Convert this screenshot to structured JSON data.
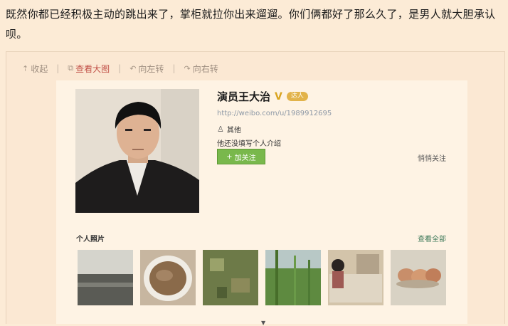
{
  "post": {
    "text": "既然你都已经积极主动的跳出来了，掌柜就拉你出来遛遛。你们俩都好了那么久了，是男人就大胆承认呗。"
  },
  "toolbar": {
    "collect": "收起",
    "view_large": "查看大图",
    "rotate_left": "向左转",
    "rotate_right": "向右转",
    "separator": "|"
  },
  "profile": {
    "name": "演员王大治",
    "verified": "V",
    "badge": "达人",
    "url": "http://weibo.com/u/1989912695",
    "gender": "其他",
    "intro": "他还没填写个人介绍",
    "follow_label": "加关注",
    "secret_follow": "悄悄关注"
  },
  "photos": {
    "title": "个人照片",
    "view_all": "查看全部",
    "more": "▼"
  },
  "colors": {
    "background": "#fcebd6",
    "card": "#fef3e4",
    "follow_green": "#79b84c",
    "view_red": "#c2534a"
  }
}
